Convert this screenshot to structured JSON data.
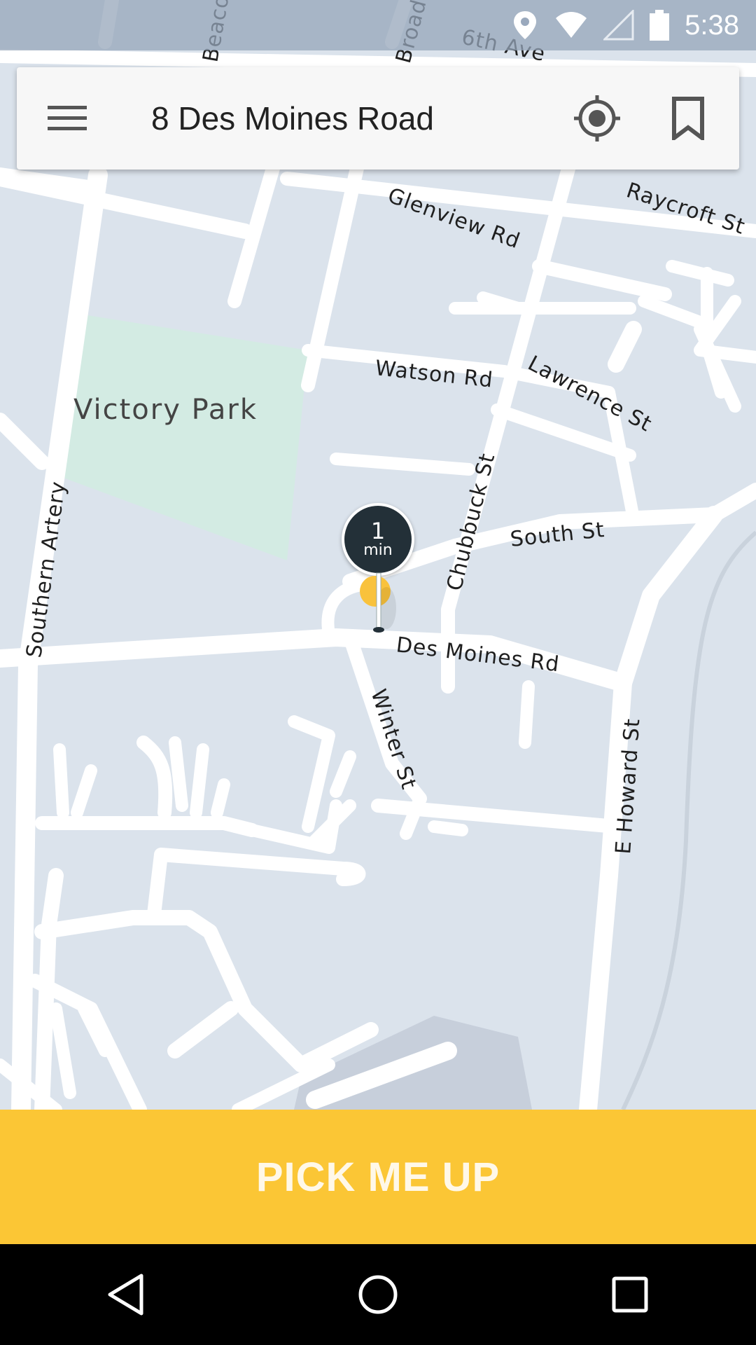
{
  "status_bar": {
    "time": "5:38",
    "icons": [
      "location-icon",
      "wifi-icon",
      "cell-signal-icon",
      "battery-icon"
    ]
  },
  "search_card": {
    "menu_icon": "hamburger-menu-icon",
    "address": "8 Des Moines Road",
    "locate_icon": "my-location-icon",
    "bookmark_icon": "bookmark-icon"
  },
  "map": {
    "park_name": "Victory Park",
    "streets": {
      "beacon": "Beaco",
      "broadway": "Broad",
      "sixth_ave": "6th Ave",
      "glenview": "Glenview Rd",
      "raycroft": "Raycroft St",
      "watson": "Watson Rd",
      "lawrence": "Lawrence St",
      "southern_artery": "Southern Artery",
      "chubbuck": "Chubbuck St",
      "south": "South St",
      "des_moines": "Des Moines Rd",
      "winter": "Winter St",
      "e_howard": "E Howard St"
    },
    "pickup_eta": {
      "value": "1",
      "unit": "min"
    }
  },
  "pickup_button": {
    "label": "PICK ME UP"
  },
  "navigation": {
    "back_icon": "back-triangle-icon",
    "home_icon": "home-circle-icon",
    "recents_icon": "recents-square-icon"
  },
  "colors": {
    "accent": "#fbc635",
    "map_background": "#dbe3ec",
    "park": "#d3ebe3",
    "road": "#ffffff",
    "eta_bubble": "#233038"
  }
}
